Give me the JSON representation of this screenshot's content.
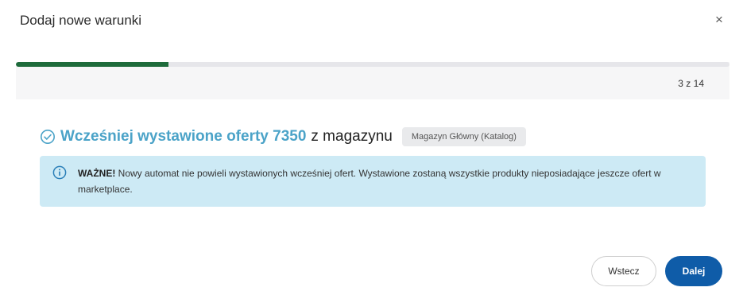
{
  "modal": {
    "title": "Dodaj nowe warunki",
    "close_symbol": "×"
  },
  "progress": {
    "fraction": 0.214,
    "counter_text": "3 z 14",
    "fill_color": "#1e6b3b"
  },
  "section": {
    "icon": "check-circle-icon",
    "heading_accent": "Wcześniej wystawione oferty 7350",
    "heading_rest": "z magazynu",
    "badge": "Magazyn Główny (Katalog)",
    "accent_color": "#4ba3c8"
  },
  "info": {
    "icon": "info-icon",
    "strong": "WAŻNE!",
    "text": " Nowy automat nie powieli wystawionych wcześniej ofert. Wystawione zostaną wszystkie produkty nieposiadające jeszcze ofert w marketplace."
  },
  "footer": {
    "back_label": "Wstecz",
    "next_label": "Dalej",
    "primary_color": "#0f5ca8"
  }
}
